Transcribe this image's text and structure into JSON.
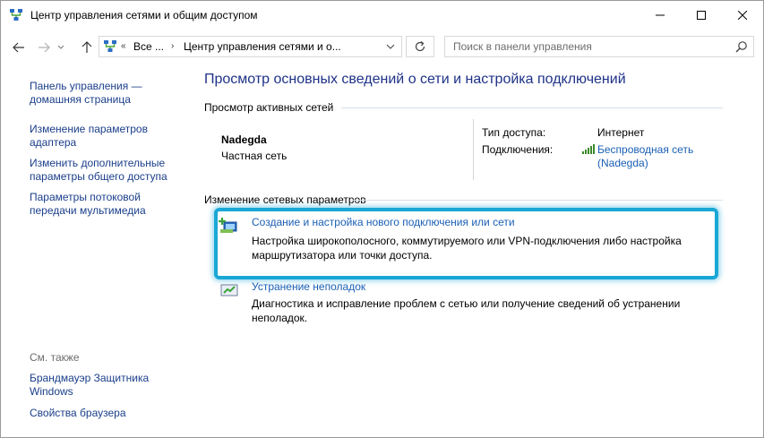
{
  "window": {
    "title": "Центр управления сетями и общим доступом",
    "controls": {
      "minimize": "—",
      "maximize": "☐",
      "close": "✕"
    }
  },
  "address": {
    "overflow": "Все ...",
    "current": "Центр управления сетями и о...",
    "search_placeholder": "Поиск в панели управления"
  },
  "sidebar": {
    "links": [
      {
        "label": "Панель управления — домашняя страница"
      },
      {
        "label": "Изменение параметров адаптера"
      },
      {
        "label": "Изменить дополнительные параметры общего доступа"
      },
      {
        "label": "Параметры потоковой передачи мультимедиа"
      }
    ],
    "see_also_heading": "См. также",
    "see_also": [
      {
        "label": "Брандмауэр Защитника Windows"
      },
      {
        "label": "Свойства браузера"
      }
    ]
  },
  "main": {
    "title": "Просмотр основных сведений о сети и настройка подключений",
    "active_networks_heading": "Просмотр активных сетей",
    "network": {
      "name": "Nadegda",
      "category": "Частная сеть",
      "access_type_label": "Тип доступа:",
      "access_type_value": "Интернет",
      "connections_label": "Подключения:",
      "connection_line1": "Беспроводная сеть",
      "connection_line2": "(Nadegda)"
    },
    "change_heading": "Изменение сетевых параметров",
    "tasks": [
      {
        "link": "Создание и настройка нового подключения или сети",
        "desc": "Настройка широкополосного, коммутируемого или VPN-подключения либо настройка маршрутизатора или точки доступа."
      },
      {
        "link": "Устранение неполадок",
        "desc": "Диагностика и исправление проблем с сетью или получение сведений об устранении неполадок."
      }
    ]
  },
  "colors": {
    "link": "#1a5fb4",
    "title": "#1e3287",
    "highlight": "#19a7d6"
  }
}
